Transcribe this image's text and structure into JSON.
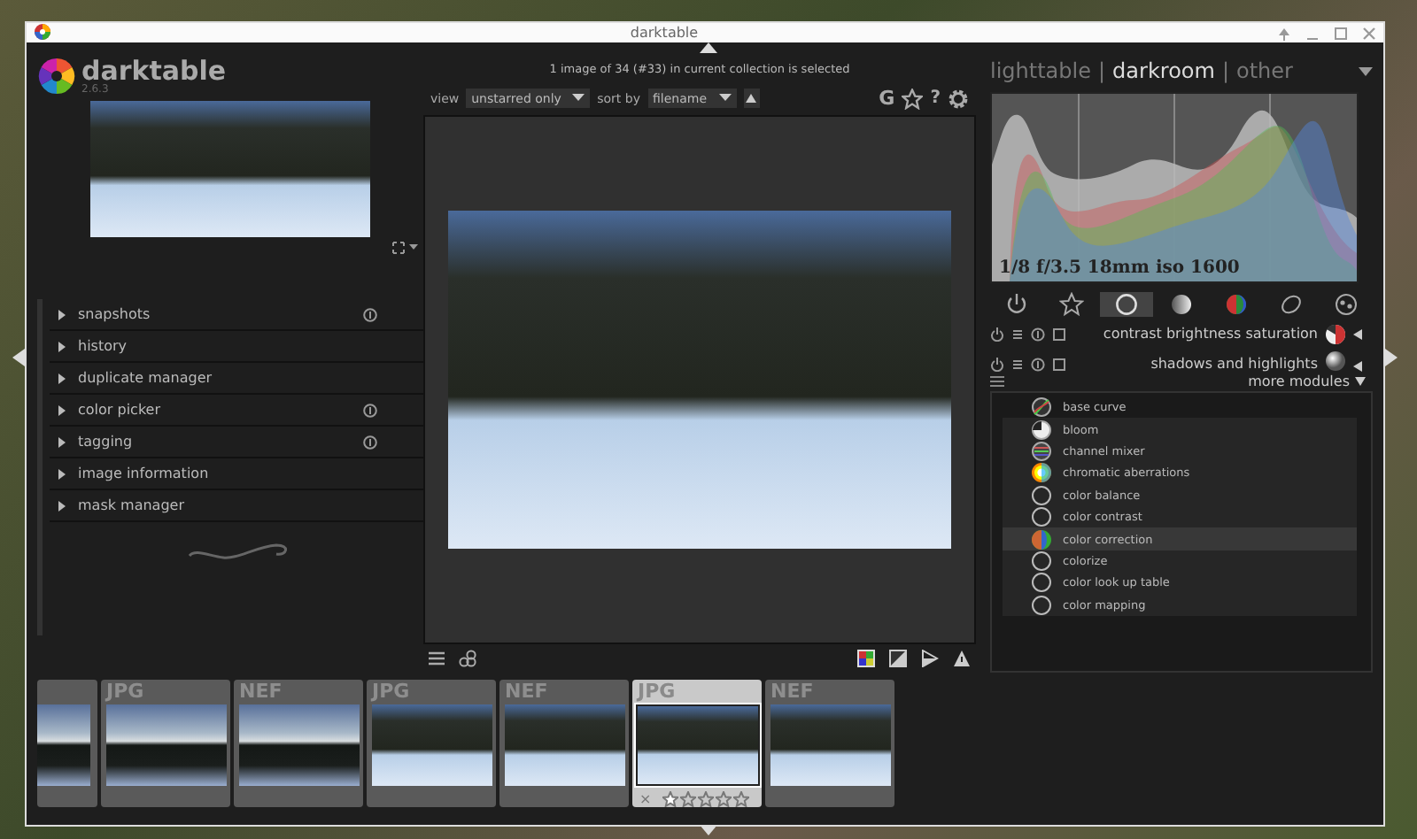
{
  "window": {
    "title": "darktable"
  },
  "app": {
    "name": "darktable",
    "version": "2.6.3"
  },
  "collection_info": "1 image of 34 (#33) in current collection is selected",
  "view_switcher": {
    "separator": "|",
    "views": [
      {
        "label": "lighttable",
        "selected": false
      },
      {
        "label": "darkroom",
        "selected": true
      },
      {
        "label": "other",
        "selected": false
      }
    ]
  },
  "toolbar": {
    "view_label": "view",
    "view_value": "unstarred only",
    "sort_label": "sort by",
    "sort_value": "filename",
    "grouping_button": "G",
    "help_button": "?"
  },
  "left_modules": [
    {
      "label": "snapshots",
      "expanded": false,
      "has_reset": true
    },
    {
      "label": "history",
      "expanded": false,
      "has_reset": false
    },
    {
      "label": "duplicate manager",
      "expanded": false,
      "has_reset": false
    },
    {
      "label": "color picker",
      "expanded": false,
      "has_reset": true
    },
    {
      "label": "tagging",
      "expanded": false,
      "has_reset": true
    },
    {
      "label": "image information",
      "expanded": false,
      "has_reset": false
    },
    {
      "label": "mask manager",
      "expanded": false,
      "has_reset": false
    }
  ],
  "histogram": {
    "exif": "1/8 f/3.5 18mm iso 1600"
  },
  "module_groups": [
    {
      "kind": "power",
      "selected": false
    },
    {
      "kind": "star",
      "selected": false
    },
    {
      "kind": "circle",
      "selected": true
    },
    {
      "kind": "tone",
      "selected": false
    },
    {
      "kind": "color",
      "selected": false
    },
    {
      "kind": "correct",
      "selected": false
    },
    {
      "kind": "effect",
      "selected": false
    }
  ],
  "active_modules": [
    {
      "name": "contrast brightness saturation",
      "kind": "tone"
    },
    {
      "name": "shadows and highlights",
      "kind": "sphere"
    }
  ],
  "more_modules": "more modules",
  "module_list": [
    {
      "name": "base curve",
      "kind": "curve",
      "selected": false
    },
    {
      "name": "bloom",
      "kind": "half",
      "selected": false
    },
    {
      "name": "channel mixer",
      "kind": "mixer",
      "selected": false
    },
    {
      "name": "chromatic aberrations",
      "kind": "rainbow",
      "selected": false
    },
    {
      "name": "color balance",
      "kind": "ring",
      "selected": false
    },
    {
      "name": "color contrast",
      "kind": "ring",
      "selected": false
    },
    {
      "name": "color correction",
      "kind": "color",
      "selected": true
    },
    {
      "name": "colorize",
      "kind": "ring",
      "selected": false
    },
    {
      "name": "color look up table",
      "kind": "ring",
      "selected": false
    },
    {
      "name": "color mapping",
      "kind": "ring",
      "selected": false
    }
  ],
  "filmstrip": [
    {
      "kind": "sunset",
      "selected": false,
      "partial": true
    },
    {
      "format": "JPG",
      "kind": "sunset",
      "selected": false,
      "partial": false
    },
    {
      "format": "NEF",
      "kind": "sunset",
      "selected": false,
      "partial": false
    },
    {
      "format": "JPG",
      "kind": "forest",
      "selected": false,
      "partial": false
    },
    {
      "format": "NEF",
      "kind": "forest",
      "selected": false,
      "partial": false
    },
    {
      "format": "JPG",
      "kind": "forest",
      "selected": true,
      "partial": false,
      "reject": "×",
      "stars": 1
    },
    {
      "format": "NEF",
      "kind": "forest",
      "selected": false,
      "partial": false
    }
  ]
}
